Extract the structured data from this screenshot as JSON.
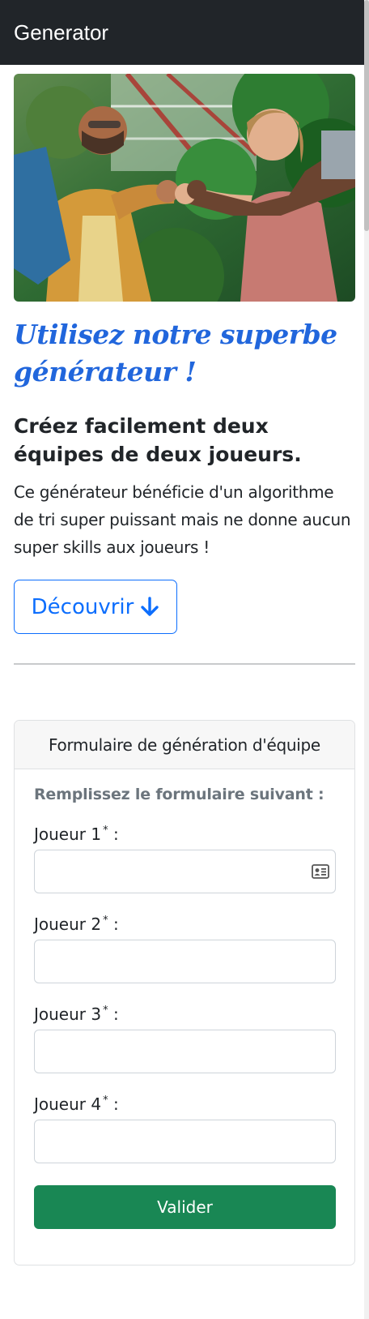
{
  "navbar": {
    "brand": "Generator"
  },
  "hero": {
    "image_description": "photo-four-friends-fist-bump",
    "title": "Utilisez notre superbe générateur !",
    "subtitle": "Créez facilement deux équipes de deux joueurs.",
    "lead": "Ce générateur bénéficie d'un algorithme de tri super puissant mais ne donne aucun super skills aux joueurs !",
    "discover_button": {
      "label": "Découvrir",
      "icon": "arrow-down-icon"
    }
  },
  "form_card": {
    "header": "Formulaire de génération d'équipe",
    "intro": "Remplissez le formulaire suivant :",
    "fields": [
      {
        "label": "Joueur 1",
        "required_mark": "*",
        "suffix": " :",
        "value": "",
        "placeholder": "",
        "icon": "contact-card-icon"
      },
      {
        "label": "Joueur 2",
        "required_mark": "*",
        "suffix": " :",
        "value": "",
        "placeholder": ""
      },
      {
        "label": "Joueur 3",
        "required_mark": "*",
        "suffix": " :",
        "value": "",
        "placeholder": ""
      },
      {
        "label": "Joueur 4",
        "required_mark": "*",
        "suffix": " :",
        "value": "",
        "placeholder": ""
      }
    ],
    "submit_label": "Valider"
  },
  "colors": {
    "navbar_bg": "#212529",
    "primary": "#0d6efd",
    "title_blue": "#2166dc",
    "success": "#198754",
    "muted": "#6c757d"
  }
}
